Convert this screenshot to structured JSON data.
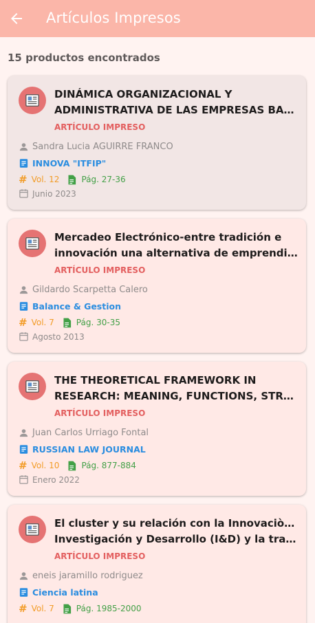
{
  "app_bar": {
    "title": "Artículos Impresos"
  },
  "results": {
    "count_text": "15 productos encontrados"
  },
  "colors": {
    "app_bar": "#fbb6a9",
    "avatar": "#e57373",
    "type": "#e35f5f",
    "journal": "#2a8de0",
    "volume": "#f29b25",
    "pages": "#43a047"
  },
  "icons": {
    "back": "arrow-left-icon",
    "article": "newspaper-icon",
    "author": "person-icon",
    "journal": "document-icon",
    "volume": "hash-icon",
    "pages": "file-icon",
    "date": "calendar-icon"
  },
  "cards": [
    {
      "title_line1": "DINÁMICA ORGANIZACIONAL Y",
      "title_line2": "ADMINISTRATIVA DE LAS EMPRESAS BAJO...",
      "type": "ARTÍCULO IMPRESO",
      "author": "Sandra Lucia AGUIRRE FRANCO",
      "journal": "INNOVA \"ITFIP\"",
      "volume": "Vol. 12",
      "pages": "Pág. 27-36",
      "date": "Junio 2023"
    },
    {
      "title_line1": "Mercadeo Electrónico-entre tradición e",
      "title_line2": "innovación una alternativa de emprendimi...",
      "type": "ARTÍCULO IMPRESO",
      "author": "Gildardo Scarpetta Calero",
      "journal": "Balance & Gestion",
      "volume": "Vol. 7",
      "pages": "Pág. 30-35",
      "date": "Agosto 2013"
    },
    {
      "title_line1": "THE THEORETICAL FRAMEWORK IN",
      "title_line2": "RESEARCH: MEANING, FUNCTIONS, STRUC...",
      "type": "ARTÍCULO IMPRESO",
      "author": "Juan Carlos Urriago Fontal",
      "journal": "RUSSIAN LAW JOURNAL",
      "volume": "Vol. 10",
      "pages": "Pág. 877-884",
      "date": "Enero 2022"
    },
    {
      "title_line1": "El cluster y su relación con la Innovaciòn, la",
      "title_line2": "Investigación y Desarrollo (I&D) y la transf...",
      "type": "ARTÍCULO IMPRESO",
      "author": "eneis jaramillo rodriguez",
      "journal": "Ciencia latina",
      "volume": "Vol. 7",
      "pages": "Pág. 1985-2000",
      "date": ""
    }
  ]
}
